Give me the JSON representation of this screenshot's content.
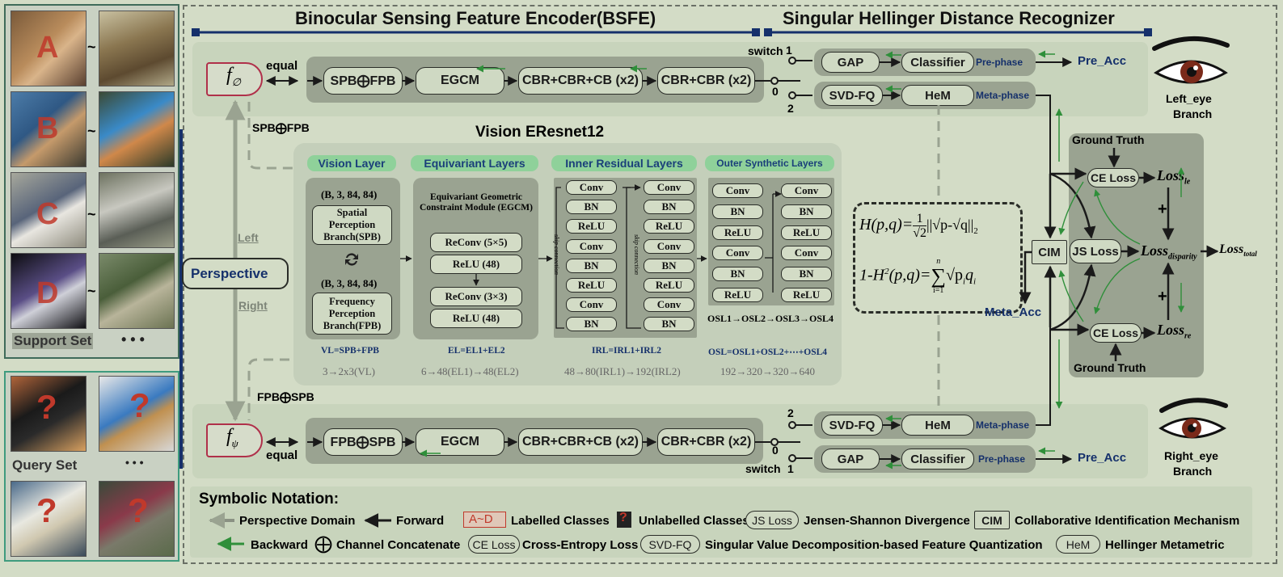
{
  "header": {
    "bsfe_title": "Binocular Sensing Feature Encoder(BSFE)",
    "shdr_title": "Singular Hellinger Distance Recognizer"
  },
  "left_panel": {
    "support": {
      "title": "Support Set",
      "ellipsis": "• • •",
      "classes": [
        {
          "letter": "A",
          "tilde": "~"
        },
        {
          "letter": "B",
          "tilde": "~"
        },
        {
          "letter": "C",
          "tilde": "~"
        },
        {
          "letter": "D",
          "tilde": "~"
        }
      ]
    },
    "query": {
      "title": "Query Set",
      "ellipsis": "• • •",
      "mark": "?"
    }
  },
  "perspective": {
    "label": "Perspective",
    "left": "Left",
    "right": "Right",
    "top_concat": "SPB⨁FPB",
    "bottom_concat": "FPB⨁SPB"
  },
  "top_branch": {
    "f_symbol": "f",
    "f_sub": "∅",
    "equal": "equal",
    "blocks": [
      "SPB⨁FPB",
      "EGCM",
      "CBR+CBR+CB (x2)",
      "CBR+CBR (x2)"
    ],
    "switch_label": "switch",
    "switch_pos1": "1",
    "switch_pos0": "0",
    "switch_pos2": "2",
    "gap": "GAP",
    "classifier": "Classifier",
    "pre_phase": "Pre-phase",
    "pre_acc": "Pre_Acc",
    "svd": "SVD-FQ",
    "hem": "HeM",
    "meta_phase": "Meta-phase",
    "eye_label_1": "Left_eye",
    "eye_label_2": "Branch"
  },
  "bottom_branch": {
    "f_symbol": "f",
    "f_sub": "ψ",
    "equal": "equal",
    "blocks": [
      "FPB⨁SPB",
      "EGCM",
      "CBR+CBR+CB (x2)",
      "CBR+CBR (x2)"
    ],
    "switch_label": "switch",
    "switch_pos1": "1",
    "switch_pos0": "0",
    "switch_pos2": "2",
    "gap": "GAP",
    "classifier": "Classifier",
    "pre_phase": "Pre-phase",
    "pre_acc": "Pre_Acc",
    "svd": "SVD-FQ",
    "hem": "HeM",
    "meta_phase": "Meta-phase",
    "eye_label_1": "Right_eye",
    "eye_label_2": "Branch"
  },
  "vision": {
    "title": "Vision EResnet12",
    "vision_layer": {
      "tag": "Vision Layer",
      "shape1": "(B, 3, 84, 84)",
      "spb": "Spatial Perception Branch(SPB)",
      "shape2": "(B, 3, 84, 84)",
      "fpb": "Frequency Perception Branch(FPB)",
      "formula": "VL=SPB+FPB",
      "dims": "3→2x3(VL)"
    },
    "equivariant": {
      "tag": "Equivariant Layers",
      "egcm": "Equivariant Geometric Constraint Module (EGCM)",
      "items": [
        "ReConv (5×5)",
        "ReLU (48)",
        "ReConv (3×3)",
        "ReLU (48)"
      ],
      "formula": "EL=EL1+EL2",
      "dims": "6→48(EL1)→48(EL2)"
    },
    "inner": {
      "tag": "Inner Residual Layers",
      "col1": [
        "Conv",
        "BN",
        "ReLU",
        "Conv",
        "BN",
        "ReLU",
        "Conv",
        "BN"
      ],
      "col2": [
        "Conv",
        "BN",
        "ReLU",
        "Conv",
        "BN",
        "ReLU",
        "Conv",
        "BN"
      ],
      "skip": "skip connection",
      "formula": "IRL=IRL1+IRL2",
      "dims": "48→80(IRL1)→192(IRL2)"
    },
    "outer": {
      "tag": "Outer Synthetic Layers",
      "col1": [
        "Conv",
        "BN",
        "ReLU",
        "Conv",
        "BN",
        "ReLU"
      ],
      "col2": [
        "Conv",
        "BN",
        "ReLU",
        "Conv",
        "BN",
        "ReLU"
      ],
      "seq": "OSL1→OSL2→OSL3→OSL4",
      "formula": "OSL=OSL1+OSL2+⋯+OSL4",
      "dims": "192→320→320→640"
    }
  },
  "formula_box": {
    "line1_lhs": "H(p,q)=",
    "line1_frac_num": "1",
    "line1_frac_den": "√2",
    "line1_rhs": "||√p-√q||",
    "line1_sub": "2",
    "line2_lhs": "1-H",
    "line2_sup": "2",
    "line2_mid": "(p,q)=",
    "line2_sum": "∑",
    "line2_sum_top": "n",
    "line2_sum_bot": "i=1",
    "line2_rhs": "√p",
    "line2_rhs_sub": "i",
    "line2_rhs2": "q",
    "line2_rhs2_sub": "i"
  },
  "cim": {
    "label": "CIM",
    "meta_acc": "Meta_Acc"
  },
  "loss_panel": {
    "gt_top": "Ground Truth",
    "gt_bottom": "Ground Truth",
    "ce_top": "CE Loss",
    "ce_bottom": "CE Loss",
    "js": "JS Loss",
    "loss_le": "Loss",
    "loss_le_sub": "le",
    "loss_re": "Loss",
    "loss_re_sub": "re",
    "loss_disp": "Loss",
    "loss_disp_sub": "disparity",
    "loss_total": "Loss",
    "loss_total_sub": "total",
    "plus_top": "+",
    "plus_bottom": "+"
  },
  "notation": {
    "title": "Symbolic Notation:",
    "row1": [
      {
        "key": "",
        "text": "Perspective Domain"
      },
      {
        "key": "",
        "text": "Forward"
      },
      {
        "key": "A~D",
        "text": "Labelled Classes"
      },
      {
        "key": "?",
        "text": "Unlabelled Classes"
      },
      {
        "key": "JS Loss",
        "text": "Jensen-Shannon Divergence"
      },
      {
        "key": "CIM",
        "text": "Collaborative Identification Mechanism"
      }
    ],
    "row2": [
      {
        "key": "",
        "text": "Backward"
      },
      {
        "key": "⨁",
        "text": "Channel Concatenate"
      },
      {
        "key": "CE Loss",
        "text": "Cross-Entropy Loss"
      },
      {
        "key": "SVD-FQ",
        "text": "Singular Value Decomposition-based Feature Quantization"
      },
      {
        "key": "HeM",
        "text": "Hellinger Metametric"
      }
    ]
  },
  "colors": {
    "navy": "#15306b",
    "green_arrow": "#2f8f3a",
    "red_letter": "#c0392b",
    "f_border": "#b0304a"
  }
}
